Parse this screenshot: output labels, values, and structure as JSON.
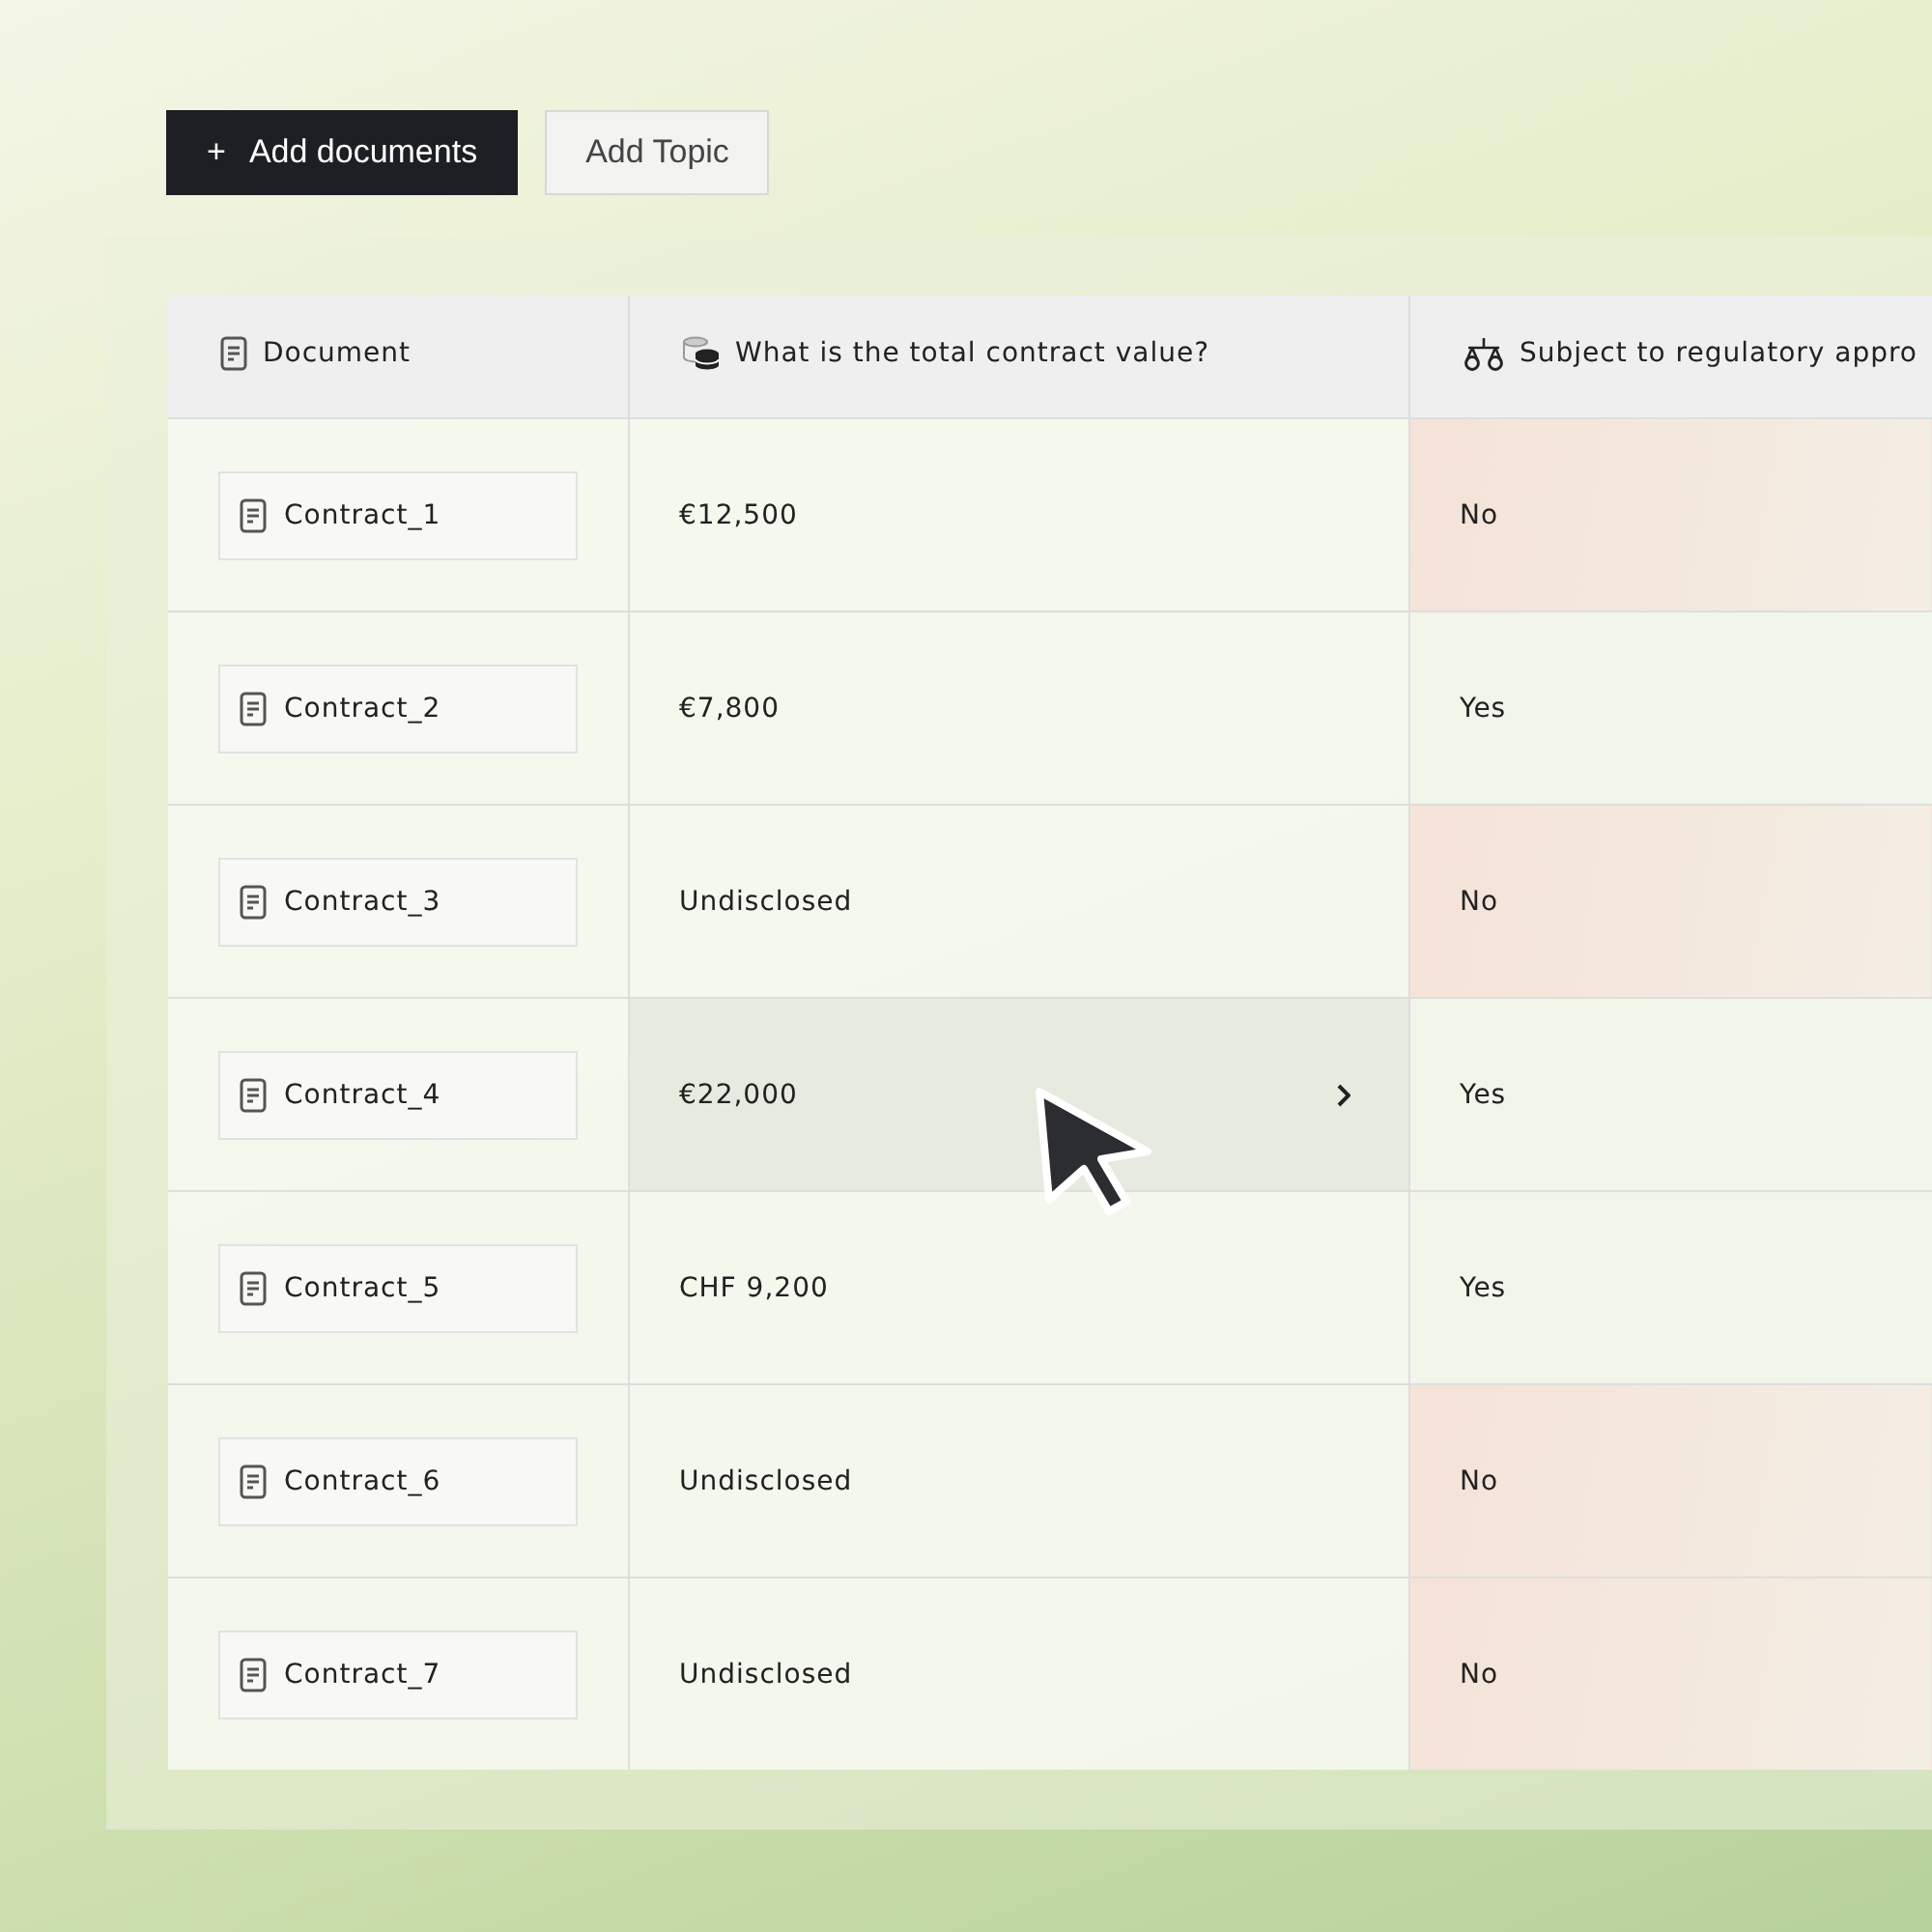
{
  "toolbar": {
    "buttons": [
      {
        "kind": "primary",
        "label": "Add documents",
        "icon": "+"
      },
      {
        "kind": "secondary",
        "label": "Add Topic"
      }
    ]
  },
  "table": {
    "columns": [
      {
        "kind": "document",
        "label": "Document"
      },
      {
        "kind": "coins",
        "label": "What is the total contract value?"
      },
      {
        "kind": "scales",
        "label": "Subject to regulatory appro"
      }
    ],
    "rows": [
      {
        "document": "Contract_1",
        "value": "€12,500",
        "answer": "No",
        "kind": "negative",
        "hovered": false
      },
      {
        "document": "Contract_2",
        "value": "€7,800",
        "answer": "Yes",
        "kind": "positive",
        "hovered": false
      },
      {
        "document": "Contract_3",
        "value": "Undisclosed",
        "answer": "No",
        "kind": "negative",
        "hovered": false
      },
      {
        "document": "Contract_4",
        "value": "€22,000",
        "answer": "Yes",
        "kind": "positive",
        "hovered": true
      },
      {
        "document": "Contract_5",
        "value": "CHF 9,200",
        "answer": "Yes",
        "kind": "positive",
        "hovered": false
      },
      {
        "document": "Contract_6",
        "value": "Undisclosed",
        "answer": "No",
        "kind": "negative",
        "hovered": false
      },
      {
        "document": "Contract_7",
        "value": "Undisclosed",
        "answer": "No",
        "kind": "negative",
        "hovered": false
      }
    ]
  }
}
